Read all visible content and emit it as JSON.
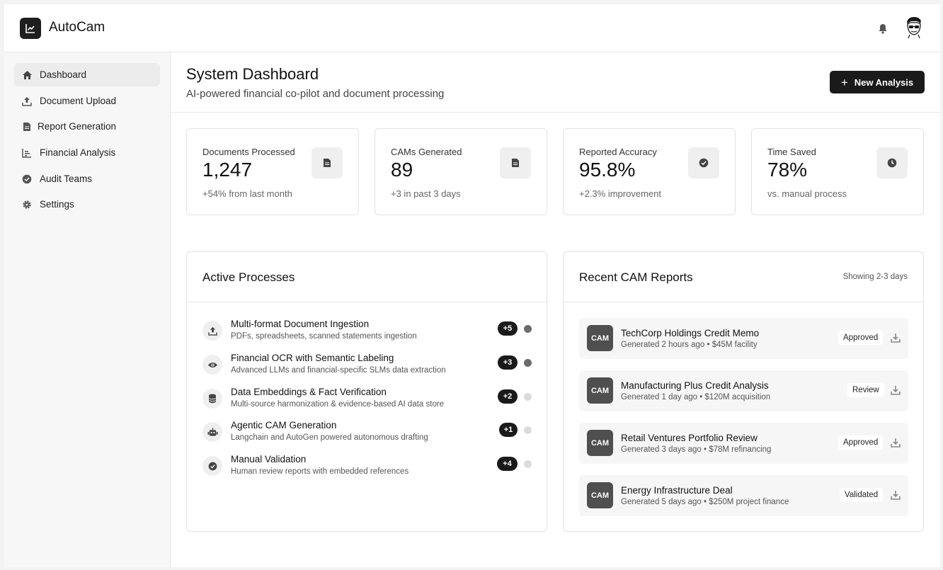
{
  "app": {
    "title": "AutoCam"
  },
  "header": {
    "bell_icon": "bell-icon",
    "avatar_icon": "avatar-cartoon-face"
  },
  "sidebar": {
    "items": [
      {
        "label": "Dashboard",
        "icon": "home-icon",
        "active": true
      },
      {
        "label": "Document Upload",
        "icon": "upload-icon",
        "active": false
      },
      {
        "label": "Report Generation",
        "icon": "document-icon",
        "active": false
      },
      {
        "label": "Financial Analysis",
        "icon": "bar-chart-icon",
        "active": false
      },
      {
        "label": "Audit Teams",
        "icon": "check-circle-icon",
        "active": false
      },
      {
        "label": "Settings",
        "icon": "gear-icon",
        "active": false
      }
    ]
  },
  "page": {
    "title": "System Dashboard",
    "subtitle": "AI-powered financial co-pilot and document processing",
    "new_button": "New Analysis"
  },
  "stats": [
    {
      "label": "Documents Processed",
      "value": "1,247",
      "note": "+54% from last month",
      "icon": "document-icon"
    },
    {
      "label": "CAMs Generated",
      "value": "89",
      "note": "+3 in past 3 days",
      "icon": "document-icon"
    },
    {
      "label": "Reported Accuracy",
      "value": "95.8%",
      "note": "+2.3% improvement",
      "icon": "check-circle-icon"
    },
    {
      "label": "Time Saved",
      "value": "78%",
      "note": "vs. manual process",
      "icon": "clock-icon"
    }
  ],
  "processes": {
    "title": "Active Processes",
    "items": [
      {
        "title": "Multi-format Document Ingestion",
        "desc": "PDFs, spreadsheets, scanned statements ingestion",
        "badge": "+5",
        "icon": "upload-icon",
        "dot": "#6b6b6b"
      },
      {
        "title": "Financial OCR with Semantic Labeling",
        "desc": "Advanced LLMs and financial-specific SLMs data extraction",
        "badge": "+3",
        "icon": "eye-icon",
        "dot": "#6b6b6b"
      },
      {
        "title": "Data Embeddings & Fact Verification",
        "desc": "Multi-source harmonization & evidence-based AI data store",
        "badge": "+2",
        "icon": "database-icon",
        "dot": "#dcdcdc"
      },
      {
        "title": "Agentic CAM Generation",
        "desc": "Langchain and AutoGen powered autonomous drafting",
        "badge": "+1",
        "icon": "robot-icon",
        "dot": "#dcdcdc"
      },
      {
        "title": "Manual Validation",
        "desc": "Human review reports with embedded references",
        "badge": "+4",
        "icon": "check-circle-icon",
        "dot": "#dcdcdc"
      }
    ]
  },
  "reports": {
    "title": "Recent CAM Reports",
    "meta": "Showing 2-3 days",
    "items": [
      {
        "tag": "CAM",
        "title": "TechCorp Holdings Credit Memo",
        "sub": "Generated 2 hours ago • $45M facility",
        "status": "Approved"
      },
      {
        "tag": "CAM",
        "title": "Manufacturing Plus Credit Analysis",
        "sub": "Generated 1 day ago • $120M acquisition",
        "status": "Review"
      },
      {
        "tag": "CAM",
        "title": "Retail Ventures Portfolio Review",
        "sub": "Generated 3 days ago • $78M refinancing",
        "status": "Approved"
      },
      {
        "tag": "CAM",
        "title": "Energy Infrastructure Deal",
        "sub": "Generated 5 days ago • $250M project finance",
        "status": "Validated"
      }
    ]
  },
  "colors": {
    "primary": "#1a1a1a",
    "sidebar_bg": "#f7f7f7",
    "border": "#e2e2e2",
    "dot_active": "#6b6b6b",
    "dot_idle": "#dcdcdc"
  }
}
